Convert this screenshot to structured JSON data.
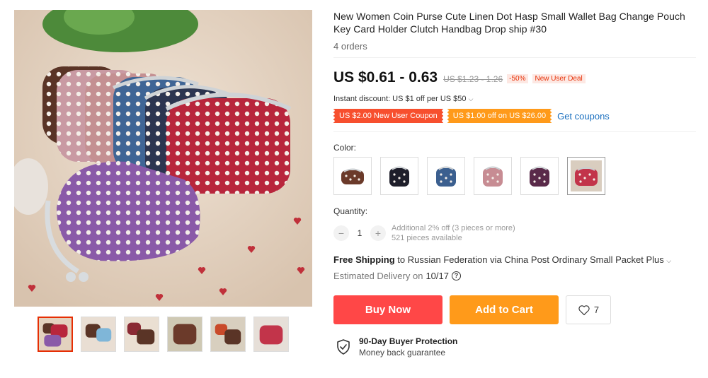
{
  "product": {
    "title": "New Women Coin Purse Cute Linen Dot Hasp Small Wallet Bag Change Pouch Key Card Holder Clutch Handbag Drop ship #30",
    "orders": "4 orders"
  },
  "price": {
    "current": "US $0.61 - 0.63",
    "original": "US $1.23 - 1.26",
    "discount": "-50%",
    "deal": "New User Deal"
  },
  "promo": {
    "instant_discount": "Instant discount: US $1 off per US $50",
    "coupon_new_user": "US $2.00 New User Coupon",
    "coupon_off": "US $1.00 off on US $26.00",
    "get_coupons": "Get coupons"
  },
  "color": {
    "label": "Color:",
    "options": [
      {
        "name": "brown",
        "hex": "#6b3a2a"
      },
      {
        "name": "black",
        "hex": "#1e1e2a"
      },
      {
        "name": "blue",
        "hex": "#3b5f8f"
      },
      {
        "name": "pink",
        "hex": "#c78c93"
      },
      {
        "name": "purple",
        "hex": "#5a2a4a"
      },
      {
        "name": "red",
        "hex": "#c2344a"
      }
    ],
    "selected_index": 5
  },
  "quantity": {
    "label": "Quantity:",
    "value": "1",
    "minus": "−",
    "plus": "+",
    "note_discount": "Additional 2% off (3 pieces or more)",
    "note_available": "521 pieces available"
  },
  "shipping": {
    "free": "Free Shipping",
    "to": "to Russian Federation via China Post Ordinary Small Packet Plus",
    "delivery_prefix": "Estimated Delivery on",
    "delivery_date": "10/17"
  },
  "actions": {
    "buy_now": "Buy Now",
    "add_to_cart": "Add to Cart",
    "wishlist_count": "7"
  },
  "protection": {
    "title": "90-Day Buyer Protection",
    "subtitle": "Money back guarantee"
  },
  "colors": {
    "accent_red": "#ff4747",
    "accent_orange": "#ff9a1a",
    "link_blue": "#1a6fbf",
    "sale_red": "#e62e04"
  },
  "gallery": {
    "thumb_count": 6,
    "active_index": 0
  }
}
